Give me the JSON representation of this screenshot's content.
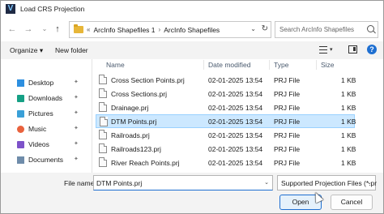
{
  "window": {
    "title": "Load CRS Projection"
  },
  "address": {
    "back": "←",
    "forward": "→",
    "up_chevron": "⌄",
    "up": "↑",
    "crumb_sep": "«",
    "crumbs": [
      "ArcInfo Shapefiles 1",
      "ArcInfo Shapefiles"
    ],
    "crumb_chevron": "›",
    "dropdown": "⌄",
    "refresh": "↻"
  },
  "search": {
    "placeholder": "Search ArcInfo Shapefiles"
  },
  "toolbar": {
    "organize": "Organize ▾",
    "new_folder": "New folder"
  },
  "sidebar": {
    "items": [
      {
        "label": "Desktop",
        "icon": "desktop-icon"
      },
      {
        "label": "Downloads",
        "icon": "downloads-icon"
      },
      {
        "label": "Pictures",
        "icon": "pictures-icon"
      },
      {
        "label": "Music",
        "icon": "music-icon"
      },
      {
        "label": "Videos",
        "icon": "videos-icon"
      },
      {
        "label": "Documents",
        "icon": "documents-icon"
      }
    ],
    "pin": "✦"
  },
  "columns": {
    "name": "Name",
    "date": "Date modified",
    "type": "Type",
    "size": "Size"
  },
  "files": [
    {
      "name": "Cross Section Points.prj",
      "date": "02-01-2025 13:54",
      "type": "PRJ File",
      "size": "1 KB"
    },
    {
      "name": "Cross Sections.prj",
      "date": "02-01-2025 13:54",
      "type": "PRJ File",
      "size": "1 KB"
    },
    {
      "name": "Drainage.prj",
      "date": "02-01-2025 13:54",
      "type": "PRJ File",
      "size": "1 KB"
    },
    {
      "name": "DTM Points.prj",
      "date": "02-01-2025 13:54",
      "type": "PRJ File",
      "size": "1 KB"
    },
    {
      "name": "Railroads.prj",
      "date": "02-01-2025 13:54",
      "type": "PRJ File",
      "size": "1 KB"
    },
    {
      "name": "Railroads123.prj",
      "date": "02-01-2025 13:54",
      "type": "PRJ File",
      "size": "1 KB"
    },
    {
      "name": "River Reach Points.prj",
      "date": "02-01-2025 13:54",
      "type": "PRJ File",
      "size": "1 KB"
    }
  ],
  "selected_index": 3,
  "bottom": {
    "file_name_label": "File name:",
    "file_name_value": "DTM Points.prj",
    "filter": "Supported Projection Files (*.pr",
    "open": "Open",
    "cancel": "Cancel",
    "dropdown": "⌄"
  },
  "colors": {
    "accent": "#1e6fd1",
    "selected_row": "#cce8ff",
    "folder": "#e7b638"
  }
}
